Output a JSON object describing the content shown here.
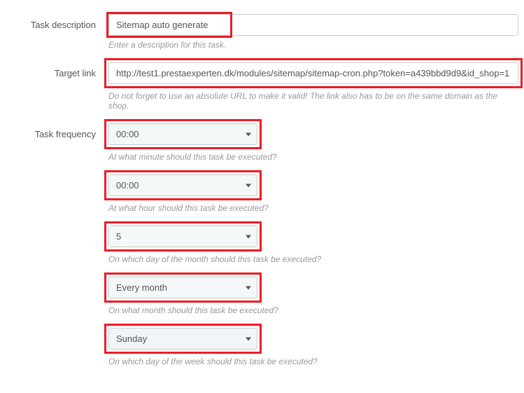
{
  "taskDescription": {
    "label": "Task description",
    "value": "Sitemap auto generate",
    "help": "Enter a description for this task."
  },
  "targetLink": {
    "label": "Target link",
    "value": "http://test1.prestaexperten.dk/modules/sitemap/sitemap-cron.php?token=a439bbd9d9&id_shop=1",
    "help": "Do not forget to use an absolute URL to make it valid! The link also has to be on the same domain as the shop."
  },
  "taskFrequency": {
    "label": "Task frequency",
    "minute": {
      "value": "00:00",
      "help": "At what minute should this task be executed?"
    },
    "hour": {
      "value": "00:00",
      "help": "At what hour should this task be executed?"
    },
    "dayOfMonth": {
      "value": "5",
      "help": "On which day of the month should this task be executed?"
    },
    "month": {
      "value": "Every month",
      "help": "On what month should this task be executed?"
    },
    "dayOfWeek": {
      "value": "Sunday",
      "help": "On which day of the week should this task be executed?"
    }
  }
}
